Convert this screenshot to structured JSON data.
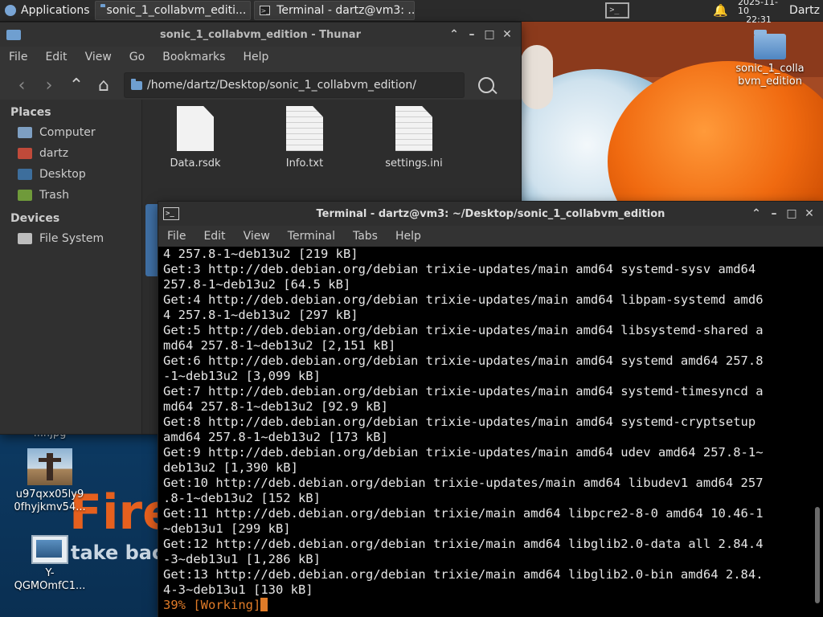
{
  "panel": {
    "applications": "Applications",
    "tasks": [
      "sonic_1_collabvm_editi...",
      "Terminal - dartz@vm3: ..."
    ],
    "date": "2025-11-10",
    "time": "22:31",
    "user": "Dartz"
  },
  "desktop": {
    "icons": [
      {
        "label": "sonic_1_colla\nbvm_edition",
        "icon": "folder-icon"
      },
      {
        "label": "u97qxx05ly9\n0fhyjkmv54...",
        "icon": "image-icon"
      },
      {
        "label": "Y-\nQGMOmfC1...",
        "icon": "image-icon"
      }
    ],
    "partial_label": "...r.jpg",
    "wallpaper_text": "Fire",
    "wallpaper_sub": "take back"
  },
  "thunar": {
    "title": "sonic_1_collabvm_edition - Thunar",
    "menu": [
      "File",
      "Edit",
      "View",
      "Go",
      "Bookmarks",
      "Help"
    ],
    "location": "/home/dartz/Desktop/sonic_1_collabvm_edition/",
    "places_header": "Places",
    "places": [
      "Computer",
      "dartz",
      "Desktop",
      "Trash"
    ],
    "devices_header": "Devices",
    "devices": [
      "File System"
    ],
    "files": [
      "Data.rsdk",
      "Info.txt",
      "settings.ini"
    ]
  },
  "terminal": {
    "title": "Terminal - dartz@vm3: ~/Desktop/sonic_1_collabvm_edition",
    "menu": [
      "File",
      "Edit",
      "View",
      "Terminal",
      "Tabs",
      "Help"
    ],
    "lines": [
      "4 257.8-1~deb13u2 [219 kB]",
      "Get:3 http://deb.debian.org/debian trixie-updates/main amd64 systemd-sysv amd64",
      "257.8-1~deb13u2 [64.5 kB]",
      "Get:4 http://deb.debian.org/debian trixie-updates/main amd64 libpam-systemd amd6",
      "4 257.8-1~deb13u2 [297 kB]",
      "Get:5 http://deb.debian.org/debian trixie-updates/main amd64 libsystemd-shared a",
      "md64 257.8-1~deb13u2 [2,151 kB]",
      "Get:6 http://deb.debian.org/debian trixie-updates/main amd64 systemd amd64 257.8",
      "-1~deb13u2 [3,099 kB]",
      "Get:7 http://deb.debian.org/debian trixie-updates/main amd64 systemd-timesyncd a",
      "md64 257.8-1~deb13u2 [92.9 kB]",
      "Get:8 http://deb.debian.org/debian trixie-updates/main amd64 systemd-cryptsetup",
      "amd64 257.8-1~deb13u2 [173 kB]",
      "Get:9 http://deb.debian.org/debian trixie-updates/main amd64 udev amd64 257.8-1~",
      "deb13u2 [1,390 kB]",
      "Get:10 http://deb.debian.org/debian trixie-updates/main amd64 libudev1 amd64 257",
      ".8-1~deb13u2 [152 kB]",
      "Get:11 http://deb.debian.org/debian trixie/main amd64 libpcre2-8-0 amd64 10.46-1",
      "~deb13u1 [299 kB]",
      "Get:12 http://deb.debian.org/debian trixie/main amd64 libglib2.0-data all 2.84.4",
      "-3~deb13u1 [1,286 kB]",
      "Get:13 http://deb.debian.org/debian trixie/main amd64 libglib2.0-bin amd64 2.84.",
      "4-3~deb13u1 [130 kB]"
    ],
    "progress": "39% [Working]"
  }
}
